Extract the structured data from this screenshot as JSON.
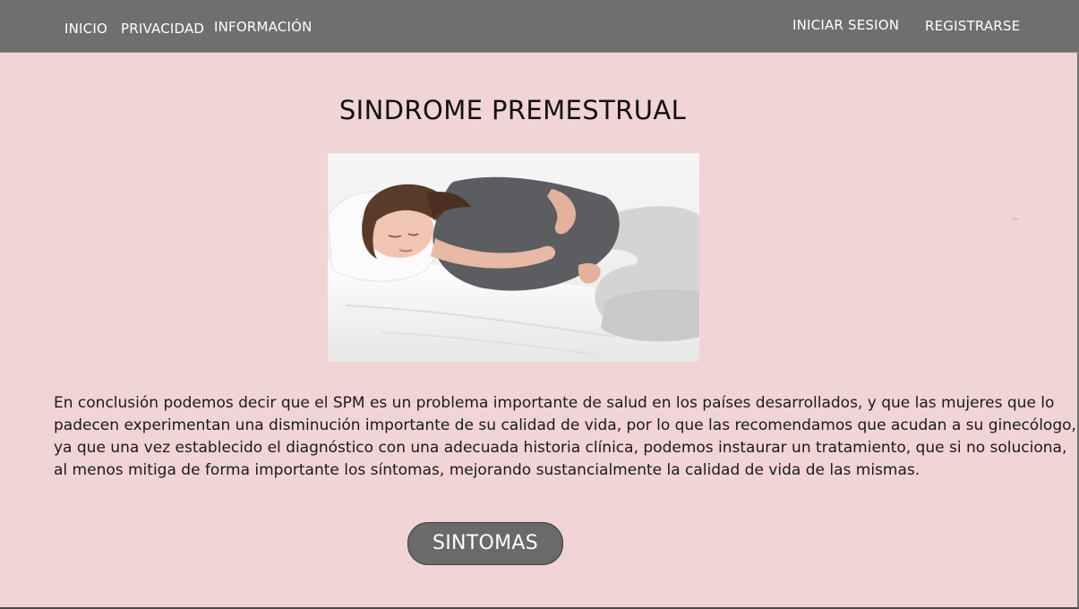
{
  "nav": {
    "left_links": [
      "INICIO",
      "PRIVACIDAD",
      "INFORMACIÓN"
    ],
    "login_label": "INICIAR SESION",
    "register_label": "REGISTRARSE"
  },
  "main": {
    "title": "SINDROME PREMESTRUAL",
    "paragraph_lines": [
      "En conclusión podemos decir que el SPM es un problema importante de salud en los países desarrollados, y que las mujeres que lo",
      "padecen experimentan una disminución importante de su calidad de vida, por lo que las recomendamos que acudan a su ginecólogo,",
      " ya que una vez establecido el diagnóstico con una adecuada historia clínica, podemos instaurar un tratamiento, que si no soluciona,",
      " al menos mitiga de forma importante los síntomas, mejorando sustancialmente la calidad de vida de las mismas."
    ],
    "button_label": "SINTOMAS"
  },
  "colors": {
    "navbar": "#6f6f6f",
    "background": "#f1d4d6",
    "button": "#6b6a6a"
  }
}
